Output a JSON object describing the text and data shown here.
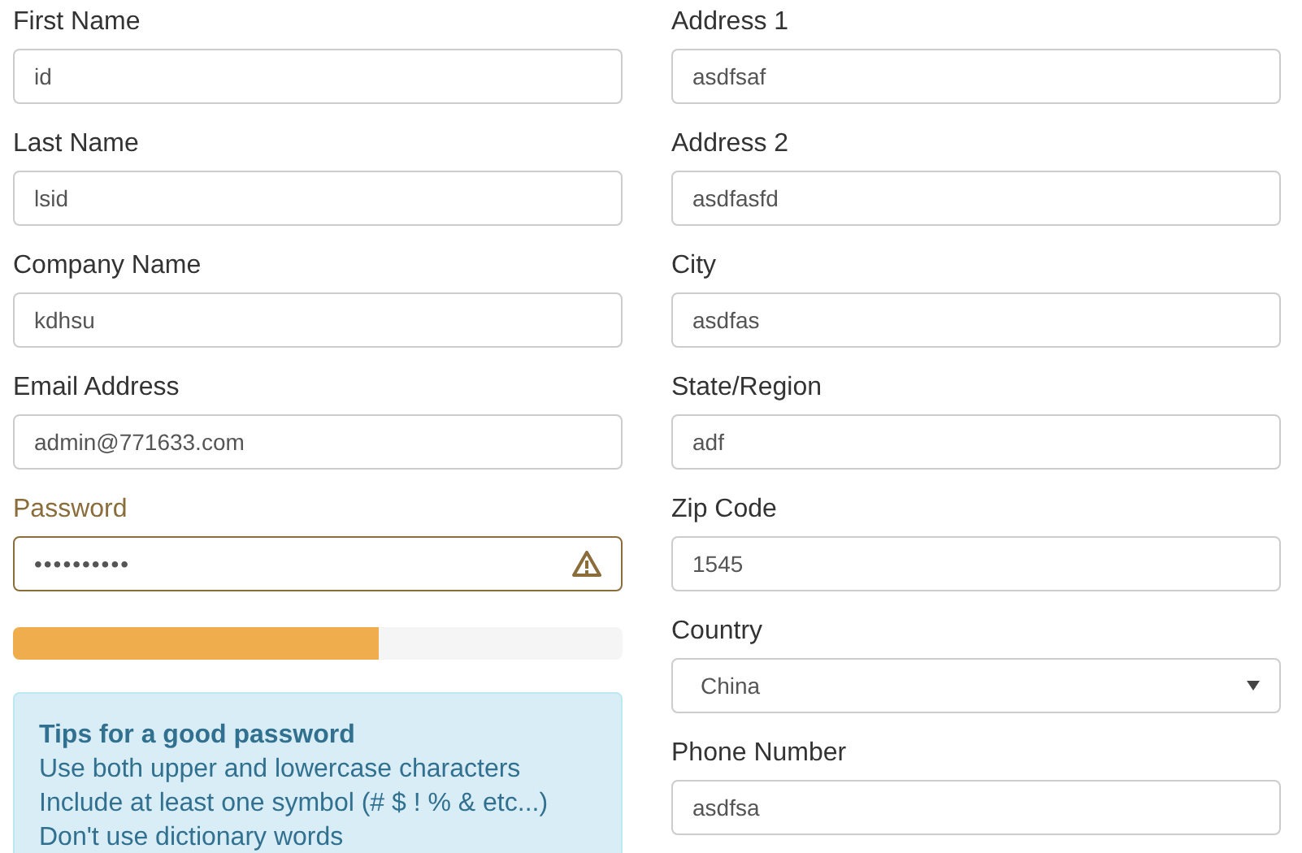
{
  "left_fields": [
    {
      "label": "First Name",
      "value": "id",
      "kind": "text",
      "warning": false
    },
    {
      "label": "Last Name",
      "value": "lsid",
      "kind": "text",
      "warning": false
    },
    {
      "label": "Company Name",
      "value": "kdhsu",
      "kind": "text",
      "warning": false
    },
    {
      "label": "Email Address",
      "value": "admin@771633.com",
      "kind": "text",
      "warning": false
    },
    {
      "label": "Password",
      "value": "••••••••••",
      "kind": "password",
      "warning": true
    }
  ],
  "password_strength": {
    "level": 0.6
  },
  "tips": {
    "title": "Tips for a good password",
    "lines": [
      "Use both upper and lowercase characters",
      "Include at least one symbol (# $ ! % & etc...)",
      "Don't use dictionary words"
    ]
  },
  "right_fields": [
    {
      "label": "Address 1",
      "value": "asdfsaf",
      "kind": "text",
      "warning": false
    },
    {
      "label": "Address 2",
      "value": "asdfasfd",
      "kind": "text",
      "warning": false
    },
    {
      "label": "City",
      "value": "asdfas",
      "kind": "text",
      "warning": false
    },
    {
      "label": "State/Region",
      "value": "adf",
      "kind": "text",
      "warning": false
    },
    {
      "label": "Zip Code",
      "value": "1545",
      "kind": "text",
      "warning": false
    },
    {
      "label": "Country",
      "value": "China",
      "kind": "select",
      "warning": false
    },
    {
      "label": "Phone Number",
      "value": "asdfsa",
      "kind": "text",
      "warning": false
    }
  ]
}
